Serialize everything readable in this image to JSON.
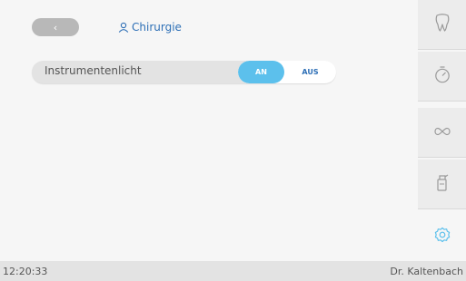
{
  "header": {
    "back_icon": "chevron-left-icon",
    "back_glyph": "‹",
    "profile_icon": "person-icon",
    "profile_name": "Chirurgie"
  },
  "settings_row": {
    "label": "Instrumentenlicht",
    "toggle_on_label": "AN",
    "toggle_off_label": "AUS",
    "selected": "AN"
  },
  "sidebar": {
    "items": [
      {
        "icon": "tooth-icon"
      },
      {
        "icon": "timer-icon"
      },
      {
        "icon": "infinity-icon"
      },
      {
        "icon": "spray-bottle-icon"
      },
      {
        "icon": "gear-icon",
        "active": true
      }
    ]
  },
  "status_bar": {
    "time": "12:20:33",
    "user": "Dr. Kaltenbach"
  },
  "colors": {
    "accent": "#5cc0ec",
    "link": "#2d6fb6",
    "back_button": "#b8b8b8",
    "row_background": "#e3e3e3"
  }
}
